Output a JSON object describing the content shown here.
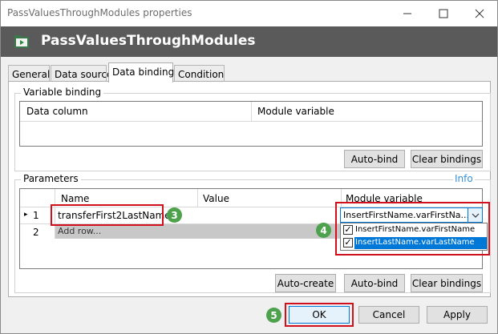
{
  "window": {
    "title": "PassValuesThroughModules properties",
    "header_title": "PassValuesThroughModules"
  },
  "tabs": [
    "General",
    "Data source",
    "Data binding",
    "Condition"
  ],
  "variable_binding": {
    "legend": "Variable binding",
    "columns": [
      "Data column",
      "Module variable"
    ],
    "buttons": {
      "auto_bind": "Auto-bind",
      "clear_bindings": "Clear bindings"
    }
  },
  "parameters": {
    "legend": "Parameters",
    "info_link": "Info",
    "columns": [
      "Name",
      "Value",
      "Module variable"
    ],
    "rows": [
      {
        "marker": "▸",
        "num": "1",
        "name": "transferFirst2LastName",
        "value": "",
        "module_variable": "InsertFirstName.varFirstNa..."
      },
      {
        "marker": "",
        "num": "2",
        "name": "Add row...",
        "value": "",
        "module_variable": ""
      }
    ],
    "dropdown_options": [
      {
        "label": "InsertFirstName.varFirstName",
        "checked": true,
        "selected": false
      },
      {
        "label": "InsertLastName.varLastName",
        "checked": true,
        "selected": true
      }
    ],
    "buttons": {
      "auto_create": "Auto-create",
      "auto_bind": "Auto-bind",
      "clear_bindings": "Clear bindings"
    }
  },
  "dialog_buttons": {
    "ok": "OK",
    "cancel": "Cancel",
    "apply": "Apply"
  },
  "badges": [
    "3",
    "4",
    "5"
  ],
  "colors": {
    "header_bg": "#5a5a5a",
    "badge_green": "#4ea24e",
    "highlight_red": "#d0101c",
    "selection_blue": "#0078d7",
    "info_link": "#3a8fd9"
  },
  "icons": {
    "minimize": "minimize-icon",
    "maximize": "maximize-icon",
    "close": "close-icon",
    "module": "module-play-icon"
  }
}
